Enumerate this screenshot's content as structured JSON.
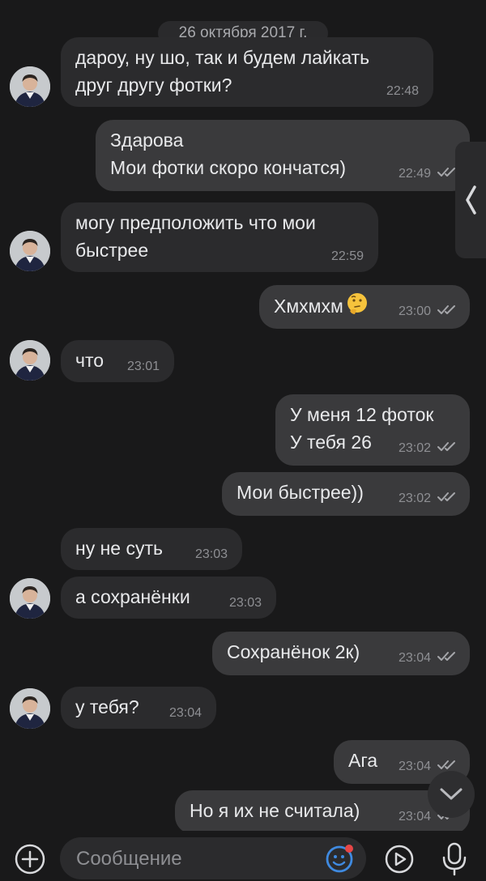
{
  "chat": {
    "date_separator": "26 октября 2017 г.",
    "messages": [
      {
        "dir": "in",
        "text": "дароу, ну шо, так и будем лайкать\nдруг другу фотки?",
        "time": "22:48"
      },
      {
        "dir": "out",
        "text": "Здарова\nМои фотки скоро кончатся)",
        "time": "22:49",
        "status": "read"
      },
      {
        "dir": "in",
        "text": "могу предположить что мои\nбыстрее",
        "time": "22:59"
      },
      {
        "dir": "out",
        "text": "Хмхмхм",
        "emoji": "thinking-face",
        "time": "23:00",
        "status": "read"
      },
      {
        "dir": "in",
        "text": "что",
        "time": "23:01"
      },
      {
        "dir": "out",
        "text": "У меня 12 фоток\nУ тебя 26",
        "time": "23:02",
        "status": "read"
      },
      {
        "dir": "out",
        "text": "Мои быстрее))",
        "time": "23:02",
        "status": "read"
      },
      {
        "dir": "in",
        "text": "ну не суть",
        "time": "23:03"
      },
      {
        "dir": "in",
        "text": "а сохранёнки",
        "time": "23:03"
      },
      {
        "dir": "out",
        "text": "Сохранёнок 2к)",
        "time": "23:04",
        "status": "read"
      },
      {
        "dir": "in",
        "text": "у тебя?",
        "time": "23:04"
      },
      {
        "dir": "out",
        "text": "Ага",
        "time": "23:04",
        "status": "read"
      },
      {
        "dir": "out",
        "text": "Но я их не считала)",
        "time": "23:04",
        "status": "read"
      }
    ]
  },
  "input": {
    "placeholder": "Сообщение"
  },
  "icons": {
    "add": "plus-circle-icon",
    "sticker": "emoji-sticker-icon",
    "send_media": "play-circle-icon",
    "voice": "microphone-icon",
    "side_panel": "chevron-left-icon",
    "scroll_down": "chevron-down-icon"
  },
  "colors": {
    "background": "#19191a",
    "incoming": "#2b2b2d",
    "outgoing": "#3a3a3c",
    "accent": "#3f8ae0",
    "badge": "#e64646"
  }
}
